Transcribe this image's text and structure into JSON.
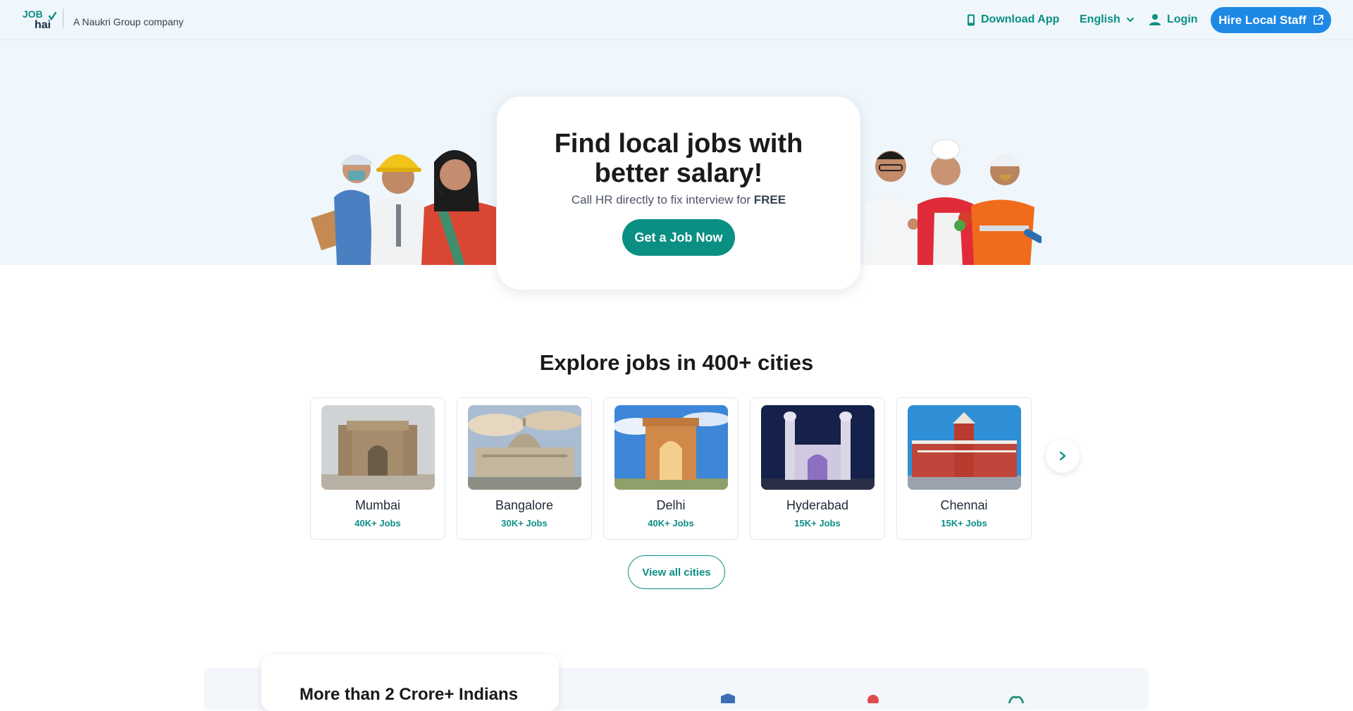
{
  "header": {
    "logo_line1": "JOB",
    "logo_line2": "hai",
    "tagline": "A Naukri Group company",
    "download_app": "Download App",
    "language": "English",
    "login": "Login",
    "hire_button": "Hire Local Staff"
  },
  "hero": {
    "title_line1": "Find local jobs with",
    "title_line2": "better salary!",
    "subtitle_prefix": "Call HR directly to fix interview for ",
    "subtitle_emphasis": "FREE",
    "cta": "Get a Job Now"
  },
  "explore": {
    "title": "Explore jobs in 400+ cities",
    "cities": [
      {
        "name": "Mumbai",
        "jobs": "40K+ Jobs"
      },
      {
        "name": "Bangalore",
        "jobs": "30K+ Jobs"
      },
      {
        "name": "Delhi",
        "jobs": "40K+ Jobs"
      },
      {
        "name": "Hyderabad",
        "jobs": "15K+ Jobs"
      },
      {
        "name": "Chennai",
        "jobs": "15K+ Jobs"
      }
    ],
    "view_all": "View all cities"
  },
  "stats": {
    "title": "More than 2 Crore+ Indians"
  },
  "colors": {
    "brand_green": "#0a8f83",
    "hire_blue": "#1e88e5",
    "hero_bg": "#eff6fc"
  },
  "icons": [
    "phone-icon",
    "chevron-down-icon",
    "user-icon",
    "external-link-icon",
    "chevron-right-icon"
  ]
}
